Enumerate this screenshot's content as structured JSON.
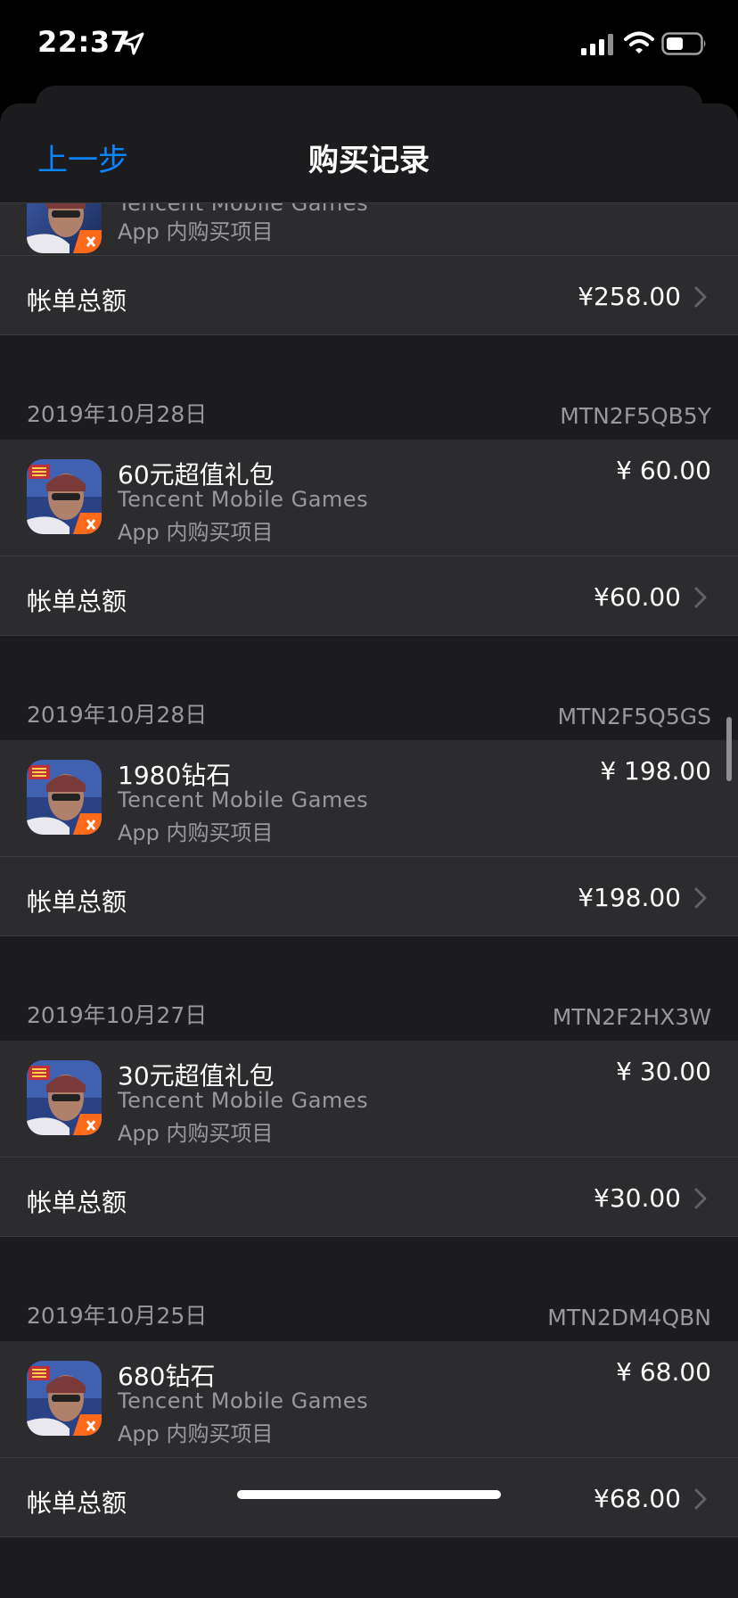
{
  "status": {
    "time": "22:37"
  },
  "nav": {
    "back": "上一步",
    "title": "购买记录"
  },
  "top": {
    "developer": "Tencent Mobile Games",
    "type": "App 内购买项目",
    "total_label": "帐单总额",
    "total": "¥258.00"
  },
  "orders": [
    {
      "date": "2019年10月28日",
      "order_id": "MTN2F5QB5Y",
      "item": "60元超值礼包",
      "developer": "Tencent Mobile Games",
      "type": "App 内购买项目",
      "price": "¥ 60.00",
      "total_label": "帐单总额",
      "total": "¥60.00"
    },
    {
      "date": "2019年10月28日",
      "order_id": "MTN2F5Q5GS",
      "item": "1980钻石",
      "developer": "Tencent Mobile Games",
      "type": "App 内购买项目",
      "price": "¥ 198.00",
      "total_label": "帐单总额",
      "total": "¥198.00"
    },
    {
      "date": "2019年10月27日",
      "order_id": "MTN2F2HX3W",
      "item": "30元超值礼包",
      "developer": "Tencent Mobile Games",
      "type": "App 内购买项目",
      "price": "¥ 30.00",
      "total_label": "帐单总额",
      "total": "¥30.00"
    },
    {
      "date": "2019年10月25日",
      "order_id": "MTN2DM4QBN",
      "item": "680钻石",
      "developer": "Tencent Mobile Games",
      "type": "App 内购买项目",
      "price": "¥ 68.00",
      "total_label": "帐单总额",
      "total": "¥68.00"
    }
  ],
  "icons": {
    "location": "location-arrow-icon",
    "signal": "cellular-signal-icon",
    "wifi": "wifi-icon",
    "battery": "battery-icon",
    "app": "game-app-icon",
    "chevron": "chevron-right-icon"
  },
  "colors": {
    "accent": "#0a84ff",
    "background": "#1c1c1e",
    "cell": "#2c2c2e",
    "secondary_text": "#98989d"
  }
}
